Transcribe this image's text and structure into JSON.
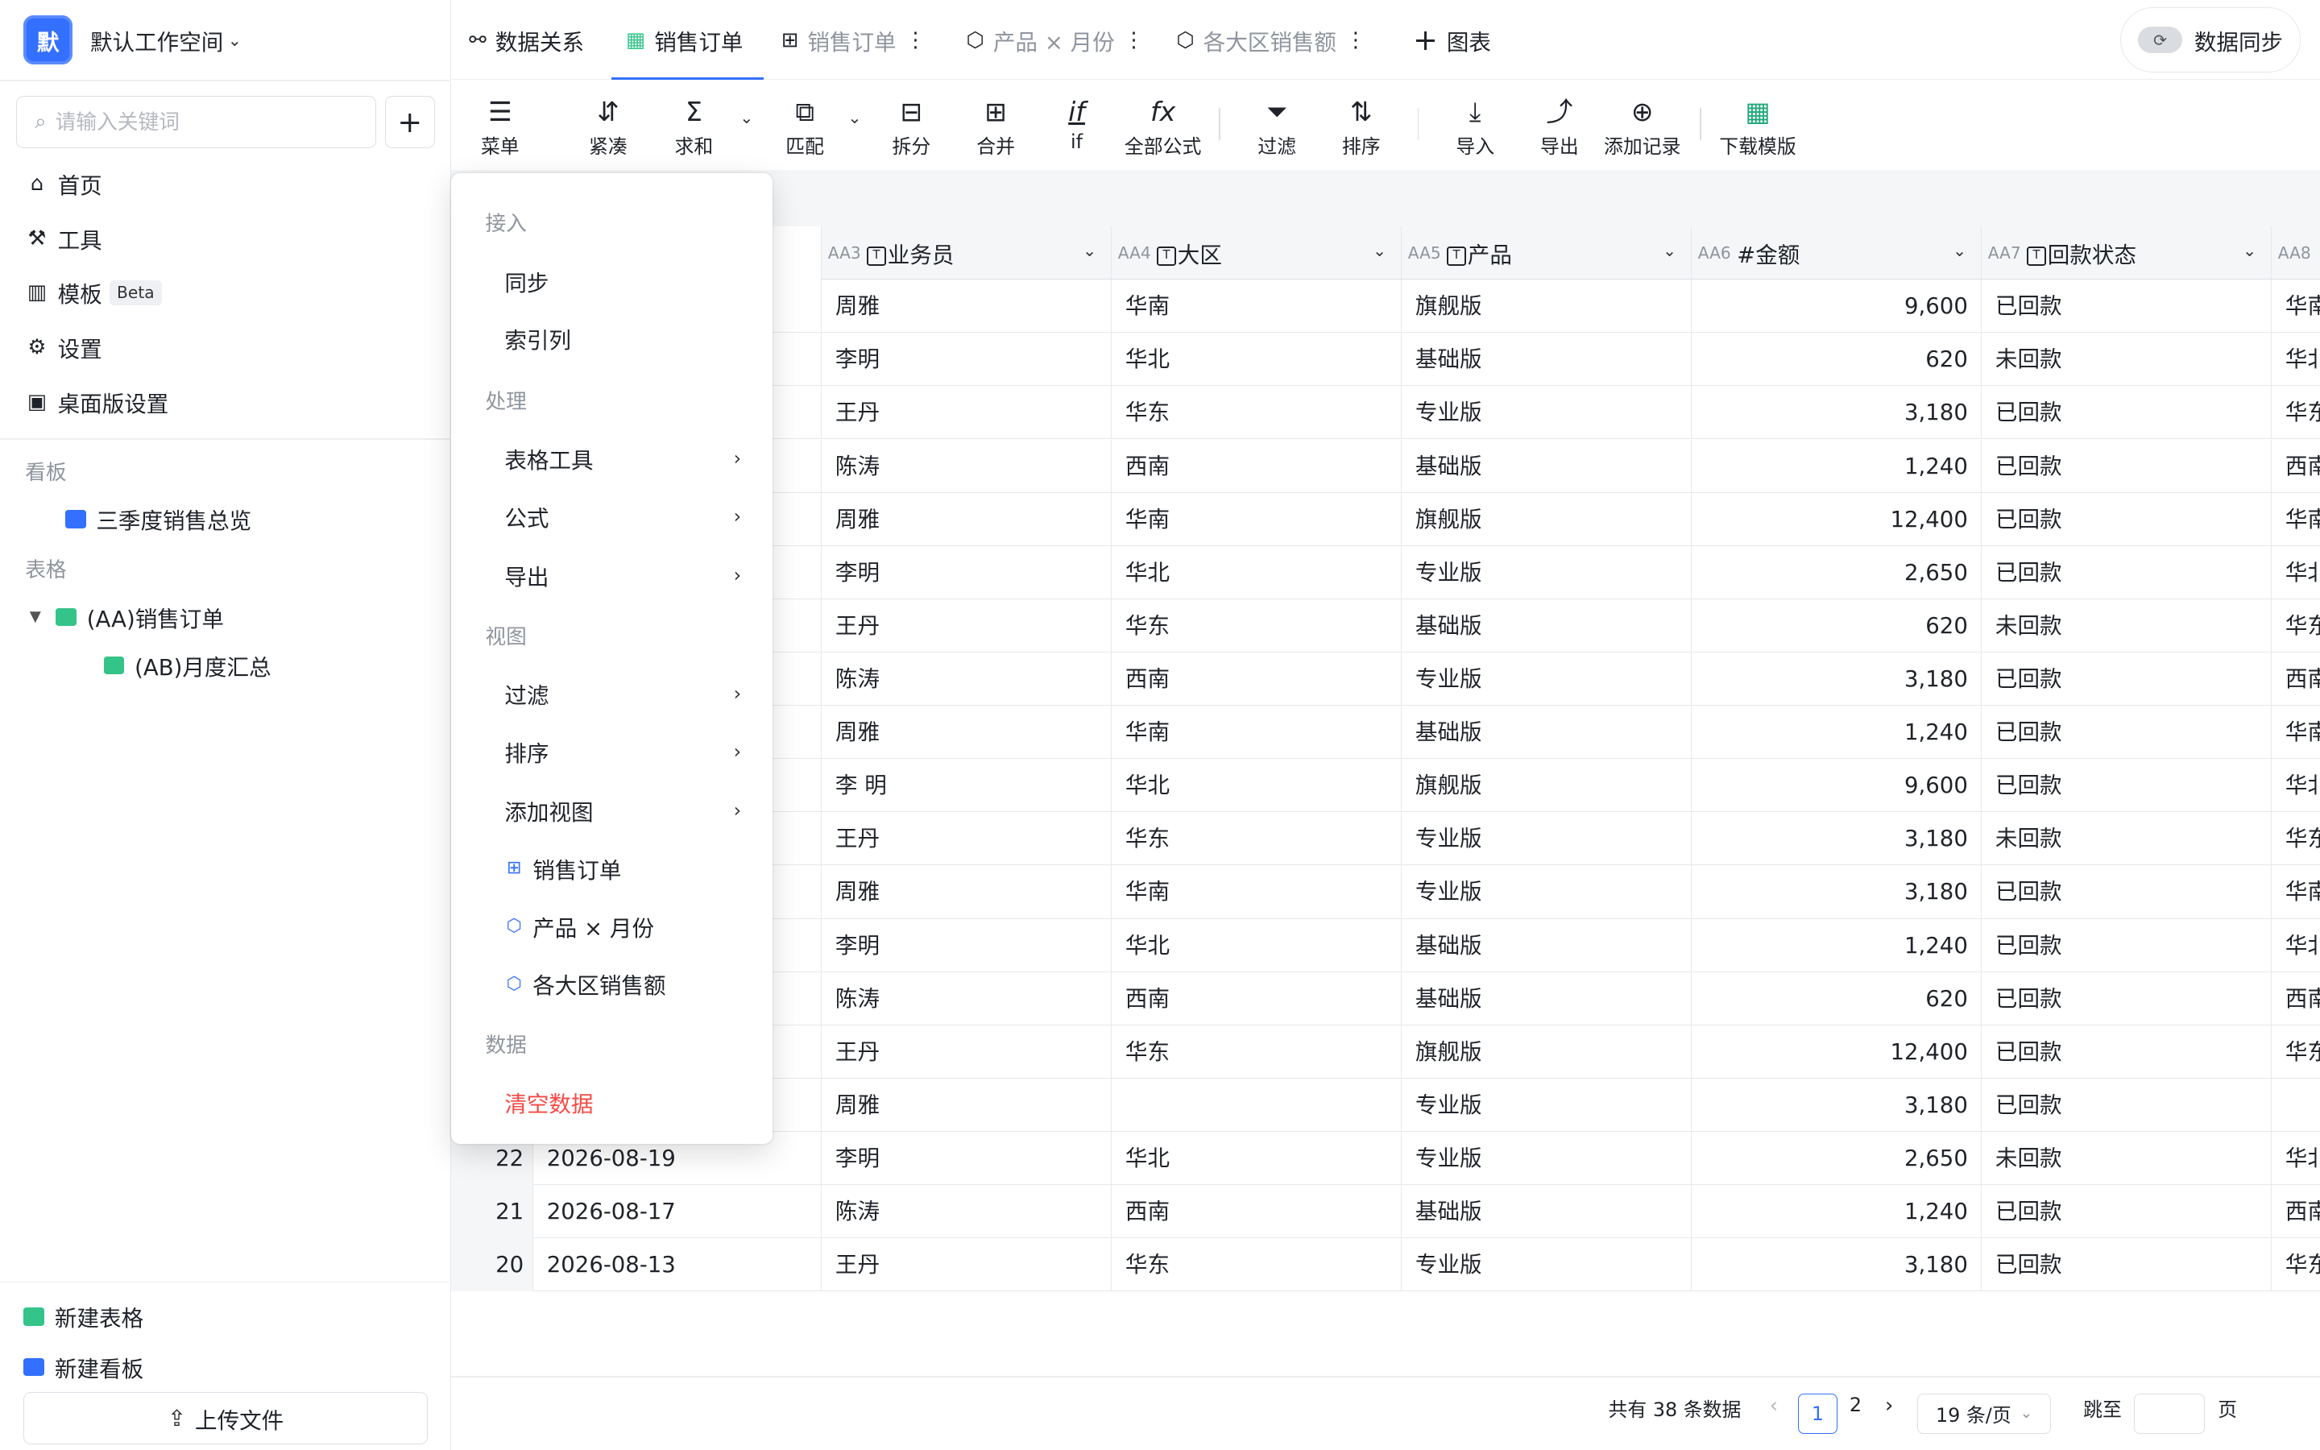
{
  "workspace": {
    "avatar": "默",
    "name": "默认工作空间"
  },
  "search": {
    "placeholder": "请输入关键词"
  },
  "nav": [
    {
      "label": "首页"
    },
    {
      "label": "工具"
    },
    {
      "label": "模板",
      "badge": "Beta"
    },
    {
      "label": "设置"
    },
    {
      "label": "桌面版设置"
    }
  ],
  "sections": {
    "dashboard": "看板",
    "tables": "表格"
  },
  "tree": {
    "dashboard_item": "三季度销售总览",
    "table_item": "(AA)销售订单",
    "sub_item": "(AB)月度汇总"
  },
  "bottom": {
    "new_table": "新建表格",
    "new_dashboard": "新建看板",
    "upload": "上传文件"
  },
  "tabs": {
    "relation": "数据关系",
    "orders_active": "销售订单",
    "orders_view": "销售订单",
    "product_month": "产品 × 月份",
    "region_sales": "各大区销售额",
    "add_chart": "图表"
  },
  "sync": {
    "label": "数据同步"
  },
  "toolbar": {
    "menu": "菜单",
    "compact": "紧凑",
    "sum": "求和",
    "match": "匹配",
    "split": "拆分",
    "merge": "合并",
    "if": "if",
    "formula": "全部公式",
    "filter": "过滤",
    "sort": "排序",
    "import": "导入",
    "export": "导出",
    "add_record": "添加记录",
    "download_tpl": "下载模版"
  },
  "columns": [
    {
      "code": "AA3",
      "name": "业务员",
      "type": "T"
    },
    {
      "code": "AA4",
      "name": "大区",
      "type": "T"
    },
    {
      "code": "AA5",
      "name": "产品",
      "type": "T"
    },
    {
      "code": "AA6",
      "name": "金额",
      "type": "#"
    },
    {
      "code": "AA7",
      "name": "回款状态",
      "type": "T"
    },
    {
      "code": "AA8",
      "name": "",
      "type": ""
    }
  ],
  "rows": [
    {
      "rep": "周雅",
      "region": "华南",
      "product": "旗舰版",
      "amount": "9,600",
      "status": "已回款",
      "next": "华南"
    },
    {
      "rep": "李明",
      "region": "华北",
      "product": "基础版",
      "amount": "620",
      "status": "未回款",
      "next": "华北"
    },
    {
      "rep": "王丹",
      "region": "华东",
      "product": "专业版",
      "amount": "3,180",
      "status": "已回款",
      "next": "华东"
    },
    {
      "rep": "陈涛",
      "region": "西南",
      "product": "基础版",
      "amount": "1,240",
      "status": "已回款",
      "next": "西南"
    },
    {
      "rep": "周雅",
      "region": "华南",
      "product": "旗舰版",
      "amount": "12,400",
      "status": "已回款",
      "next": "华南"
    },
    {
      "rep": "李明",
      "region": "华北",
      "product": "专业版",
      "amount": "2,650",
      "status": "已回款",
      "next": "华北"
    },
    {
      "rep": "王丹",
      "region": "华东",
      "product": "基础版",
      "amount": "620",
      "status": "未回款",
      "next": "华东"
    },
    {
      "rep": "陈涛",
      "region": "西南",
      "product": "专业版",
      "amount": "3,180",
      "status": "已回款",
      "next": "西南"
    },
    {
      "rep": "周雅",
      "region": "华南",
      "product": "基础版",
      "amount": "1,240",
      "status": "已回款",
      "next": "华南"
    },
    {
      "rep": "李 明",
      "region": "华北",
      "product": "旗舰版",
      "amount": "9,600",
      "status": "已回款",
      "next": "华北"
    },
    {
      "rep": "王丹",
      "region": "华东",
      "product": "专业版",
      "amount": "3,180",
      "status": "未回款",
      "next": "华东"
    },
    {
      "rep": "周雅",
      "region": "华南",
      "product": "专业版",
      "amount": "3,180",
      "status": "已回款",
      "next": "华南"
    },
    {
      "rep": "李明",
      "region": "华北",
      "product": "基础版",
      "amount": "1,240",
      "status": "已回款",
      "next": "华北"
    },
    {
      "rep": "陈涛",
      "region": "西南",
      "product": "基础版",
      "amount": "620",
      "status": "已回款",
      "next": "西南"
    },
    {
      "rep": "王丹",
      "region": "华东",
      "product": "旗舰版",
      "amount": "12,400",
      "status": "已回款",
      "next": "华东"
    },
    {
      "rep": "周雅",
      "region": "",
      "product": "专业版",
      "amount": "3,180",
      "status": "已回款",
      "next": ""
    },
    {
      "no": "22",
      "date": "2026-08-19",
      "rep": "李明",
      "region": "华北",
      "product": "专业版",
      "amount": "2,650",
      "status": "未回款",
      "next": "华北"
    },
    {
      "no": "21",
      "date": "2026-08-17",
      "rep": "陈涛",
      "region": "西南",
      "product": "基础版",
      "amount": "1,240",
      "status": "已回款",
      "next": "西南"
    },
    {
      "no": "20",
      "date": "2026-08-13",
      "rep": "王丹",
      "region": "华东",
      "product": "专业版",
      "amount": "3,180",
      "status": "已回款",
      "next": "华东"
    }
  ],
  "menu": {
    "h_access": "接入",
    "sync": "同步",
    "index_col": "索引列",
    "h_process": "处理",
    "table_tools": "表格工具",
    "formula": "公式",
    "export": "导出",
    "h_view": "视图",
    "filter": "过滤",
    "sort": "排序",
    "add_view": "添加视图",
    "view_orders": "销售订单",
    "view_product_month": "产品 × 月份",
    "view_region": "各大区销售额",
    "h_data": "数据",
    "clear": "清空数据"
  },
  "pagination": {
    "total": "共有 38 条数据",
    "page1": "1",
    "page2": "2",
    "per_page": "19 条/页",
    "jump": "跳至",
    "page_unit": "页"
  },
  "colors": {
    "accent": "#3370ff",
    "danger": "#f54a45",
    "table_icon": "#34c48a"
  }
}
